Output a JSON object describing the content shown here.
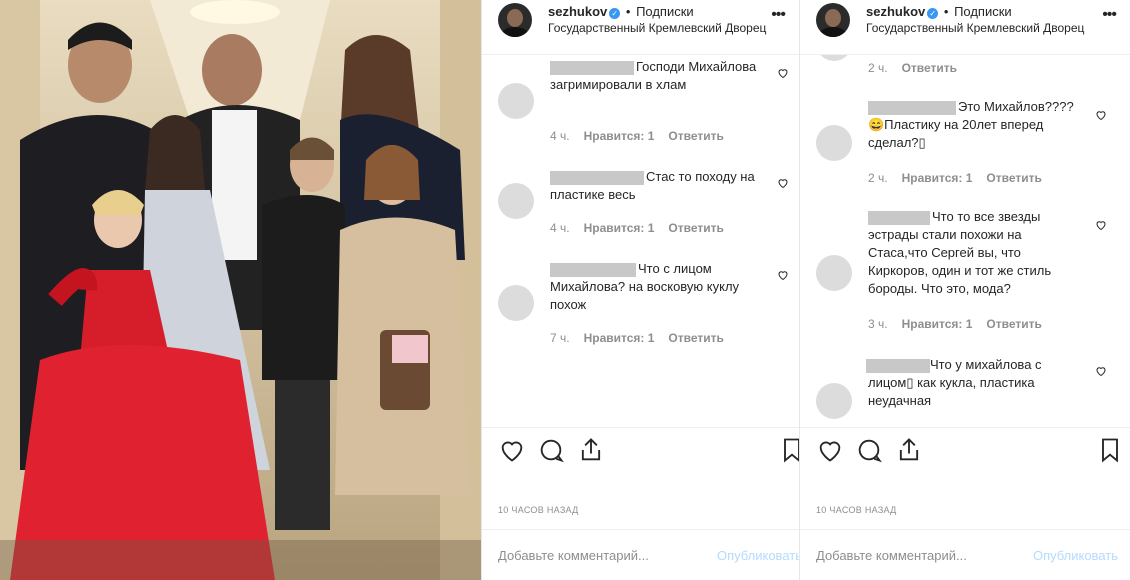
{
  "photo": {
    "alt_subject": "family photo"
  },
  "post": {
    "username": "sezhukov",
    "verified_mark": "✓",
    "separator": "•",
    "follow_label": "Подписки",
    "location": "Государственный Кремлевский Дворец",
    "more_icon": "•••",
    "time_ago": "10 ЧАСОВ НАЗАД",
    "comment_placeholder": "Добавьте комментарий...",
    "publish_label": "Опубликовать",
    "colors": {
      "verified": "#3897f0",
      "publish": "#b3dbff",
      "meta": "#8e8e8e"
    }
  },
  "panel1": {
    "comments": [
      {
        "text": "Господи Михайлова загримировали в хлам",
        "time": "4 ч.",
        "likes": "Нравится: 1",
        "reply": "Ответить"
      },
      {
        "text": "Стас то походу на пластике весь",
        "time": "4 ч.",
        "likes": "Нравится: 1",
        "reply": "Ответить"
      },
      {
        "text": "Что с лицом Михайлова? на восковую куклу похож",
        "time": "7 ч.",
        "likes": "Нравится: 1",
        "reply": "Ответить"
      }
    ]
  },
  "panel2": {
    "partial": {
      "time": "2 ч.",
      "reply": "Ответить"
    },
    "comments": [
      {
        "text": "Это Михайлов???? 😄Пластику на 20лет вперед сделал?▯",
        "time": "2 ч.",
        "likes": "Нравится: 1",
        "reply": "Ответить"
      },
      {
        "text": "Что то все звезды эстрады стали похожи на Стаса,что Сергей вы, что Киркоров, один и тот же стиль бороды. Что это, мода?",
        "time": "3 ч.",
        "likes": "Нравится: 1",
        "reply": "Ответить"
      },
      {
        "text": "Что у михайлова с лицом▯ как кукла, пластика неудачная"
      }
    ]
  }
}
